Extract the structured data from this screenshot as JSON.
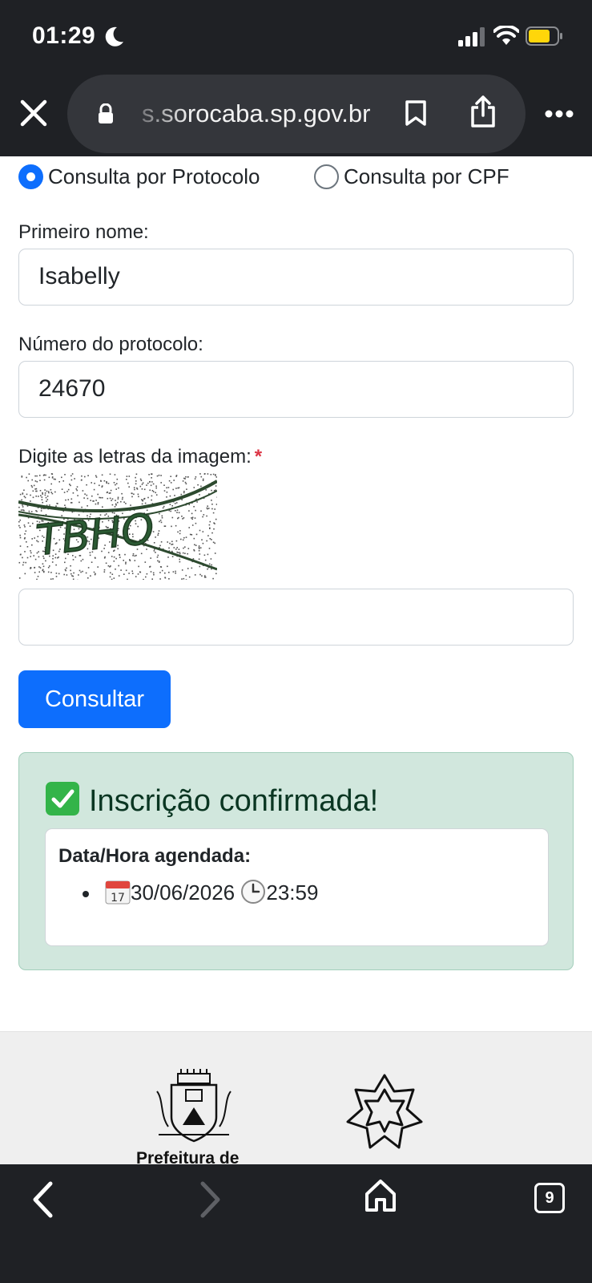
{
  "status_bar": {
    "time": "01:29"
  },
  "browser": {
    "url": "s.sorocaba.sp.gov.br"
  },
  "form": {
    "radio_protocolo_label": "Consulta por Protocolo",
    "radio_cpf_label": "Consulta por CPF",
    "selected_mode": "Consulta por Protocolo",
    "first_name_label": "Primeiro nome:",
    "first_name_value": "Isabelly",
    "protocol_label": "Número do protocolo:",
    "protocol_value": "24670",
    "captcha_label": "Digite as letras da imagem:",
    "captcha_required_mark": "*",
    "captcha_image_text": "TBHO",
    "captcha_input_value": "",
    "submit_label": "Consultar"
  },
  "result": {
    "title": "Inscrição confirmada!",
    "card_title": "Data/Hora agendada:",
    "date": "30/06/2026",
    "time": "23:59"
  },
  "footer": {
    "logo_text": "Prefeitura de"
  },
  "toolbar": {
    "tab_count": "9"
  },
  "colors": {
    "primary": "#0d6efd",
    "success_bg": "#d1e7dd",
    "success_text": "#0a3622",
    "chrome_bg": "#1f2125"
  }
}
